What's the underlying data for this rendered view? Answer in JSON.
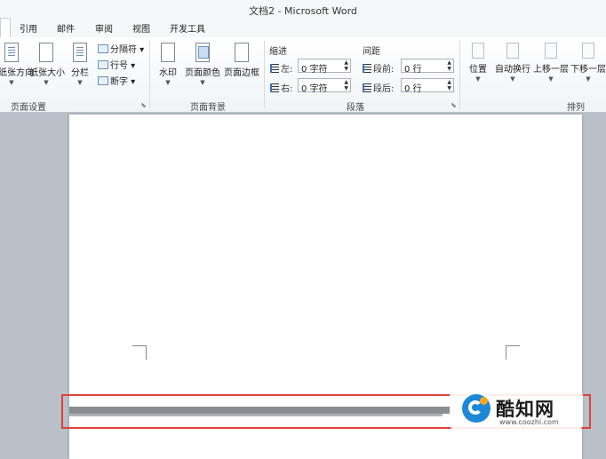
{
  "window": {
    "title": "文档2 - Microsoft Word"
  },
  "tabs": [
    "引用",
    "邮件",
    "审阅",
    "视图",
    "开发工具"
  ],
  "ribbon": {
    "page_setup": {
      "label": "页面设置",
      "orientation": "纸张方向",
      "size": "纸张大小",
      "columns": "分栏",
      "breaks": "分隔符",
      "line_numbers": "行号",
      "hyphenation": "断字"
    },
    "page_background": {
      "label": "页面背景",
      "watermark": "水印",
      "page_color": "页面颜色",
      "page_borders": "页面边框"
    },
    "paragraph": {
      "label": "段落",
      "indent_title": "缩进",
      "indent_left_label": "左:",
      "indent_left_value": "0 字符",
      "indent_right_label": "右:",
      "indent_right_value": "0 字符",
      "spacing_title": "间距",
      "spacing_before_label": "段前:",
      "spacing_before_value": "0 行",
      "spacing_after_label": "段后:",
      "spacing_after_value": "0 行"
    },
    "arrange": {
      "label": "排列",
      "position": "位置",
      "wrap_text": "自动换行",
      "bring_forward": "上移一层",
      "send_backward": "下移一层"
    }
  },
  "watermark": {
    "name": "酷知网",
    "url": "www.coozhi.com"
  }
}
